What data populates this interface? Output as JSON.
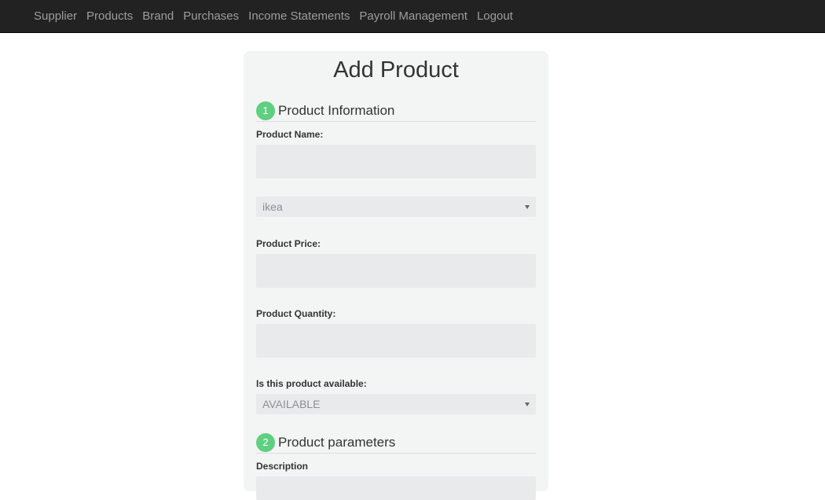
{
  "navbar": {
    "links": [
      "Supplier",
      "Products",
      "Brand",
      "Purchases",
      "Income Statements",
      "Payroll Management",
      "Logout"
    ]
  },
  "form": {
    "title": "Add Product",
    "section1": {
      "number": "1",
      "title": "Product Information"
    },
    "product_name": {
      "label": "Product Name:",
      "value": ""
    },
    "brand_select": {
      "value": "ikea"
    },
    "product_price": {
      "label": "Product Price:",
      "value": ""
    },
    "product_quantity": {
      "label": "Product Quantity:",
      "value": ""
    },
    "availability": {
      "label": "Is this product available:",
      "value": "AVAILABLE"
    },
    "section2": {
      "number": "2",
      "title": "Product parameters"
    },
    "description": {
      "label": "Description"
    }
  },
  "colors": {
    "navbar_bg": "#222222",
    "nav_text": "#9d9d9d",
    "step_badge": "#5fcf80",
    "card_bg": "#f3f5f5",
    "input_bg": "#e8eaeb"
  }
}
